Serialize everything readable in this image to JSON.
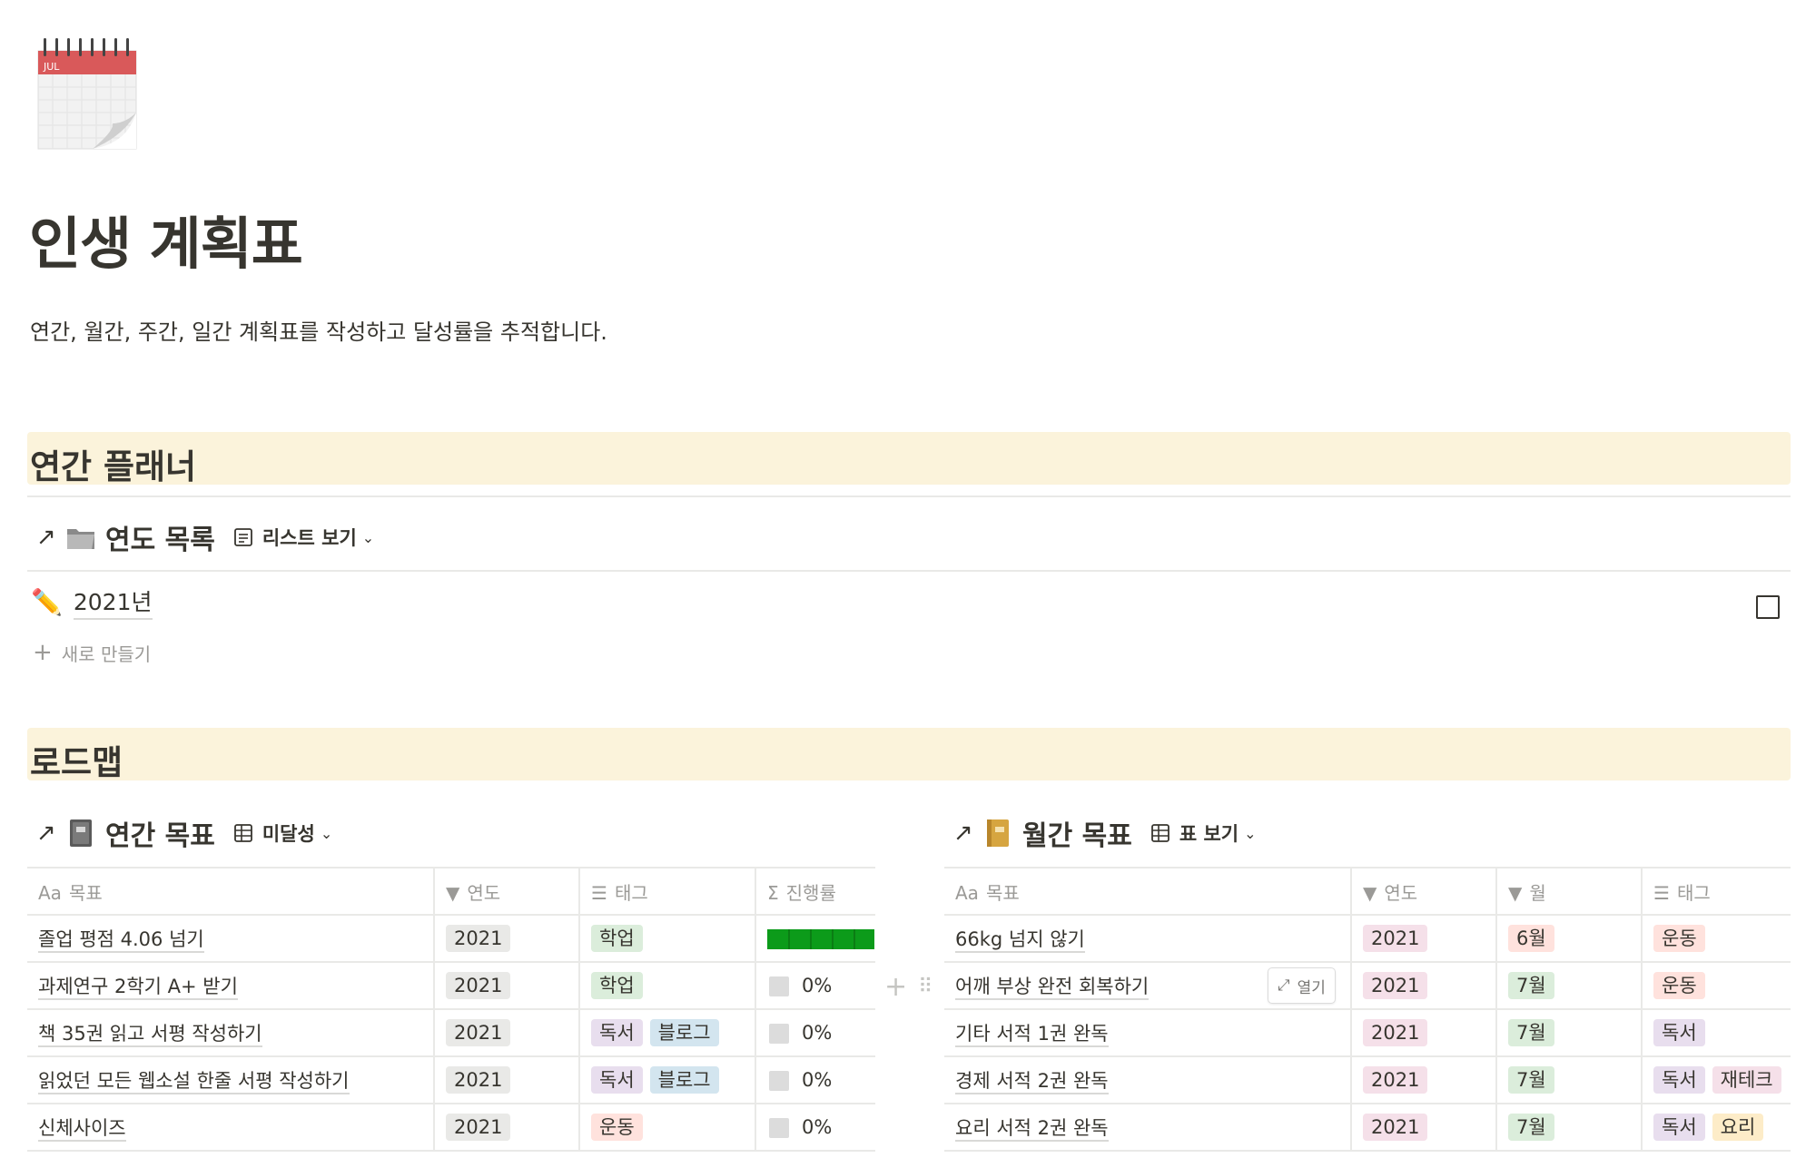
{
  "page": {
    "icon": "calendar-icon",
    "icon_month": "JUL",
    "title": "인생 계획표",
    "description": "연간, 월간, 주간, 일간 계획표를 작성하고 달성률을 추적합니다."
  },
  "colors": {
    "section_band": "#fbf3db",
    "tag_year": "#e9e9e7",
    "tag_green": "#dbeddb",
    "tag_purple": "#e8deee",
    "tag_blue": "#d3e5ef",
    "tag_red": "#ffe2dd",
    "tag_pink": "#f5e0e9",
    "tag_orange": "#fdecc8",
    "progress_green": "#0c9b1a"
  },
  "sections": {
    "annual": "연간 플래너",
    "roadmap": "로드맵"
  },
  "year_list": {
    "title": "연도 목록",
    "icon": "folder-icon",
    "view_label": "리스트 보기",
    "items": [
      {
        "emoji": "pencil-icon",
        "label": "2021년"
      }
    ],
    "new_label": "새로 만들기"
  },
  "annual_goals": {
    "title": "연간 목표",
    "icon": "notebook-icon",
    "view_label": "미달성",
    "columns": [
      "목표",
      "연도",
      "태그",
      "진행률"
    ],
    "rows": [
      {
        "goal": "졸업 평점 4.06 넘기",
        "year": "2021",
        "tags": [
          "학업"
        ],
        "progress": 1.0,
        "progress_label": ""
      },
      {
        "goal": "과제연구 2학기 A+ 받기",
        "year": "2021",
        "tags": [
          "학업"
        ],
        "progress": 0,
        "progress_label": "0%"
      },
      {
        "goal": "책 35권 읽고 서평 작성하기",
        "year": "2021",
        "tags": [
          "독서",
          "블로그"
        ],
        "progress": 0,
        "progress_label": "0%"
      },
      {
        "goal": "읽었던 모든 웹소설 한줄 서평 작성하기",
        "year": "2021",
        "tags": [
          "독서",
          "블로그"
        ],
        "progress": 0,
        "progress_label": "0%"
      },
      {
        "goal": "신체사이즈",
        "year": "2021",
        "tags": [
          "운동"
        ],
        "progress": 0,
        "progress_label": "0%"
      }
    ]
  },
  "monthly_goals": {
    "title": "월간 목표",
    "icon": "ledger-icon",
    "view_label": "표 보기",
    "columns": [
      "목표",
      "연도",
      "월",
      "태그"
    ],
    "open_label": "열기",
    "rows": [
      {
        "goal": "66kg 넘지 않기",
        "year": "2021",
        "month": "6월",
        "tags": [
          "운동"
        ]
      },
      {
        "goal": "어깨 부상 완전 회복하기",
        "year": "2021",
        "month": "7월",
        "tags": [
          "운동"
        ]
      },
      {
        "goal": "기타 서적 1권 완독",
        "year": "2021",
        "month": "7월",
        "tags": [
          "독서"
        ]
      },
      {
        "goal": "경제 서적 2권 완독",
        "year": "2021",
        "month": "7월",
        "tags": [
          "독서",
          "재테크"
        ]
      },
      {
        "goal": "요리 서적 2권 완독",
        "year": "2021",
        "month": "7월",
        "tags": [
          "독서",
          "요리"
        ]
      }
    ]
  }
}
